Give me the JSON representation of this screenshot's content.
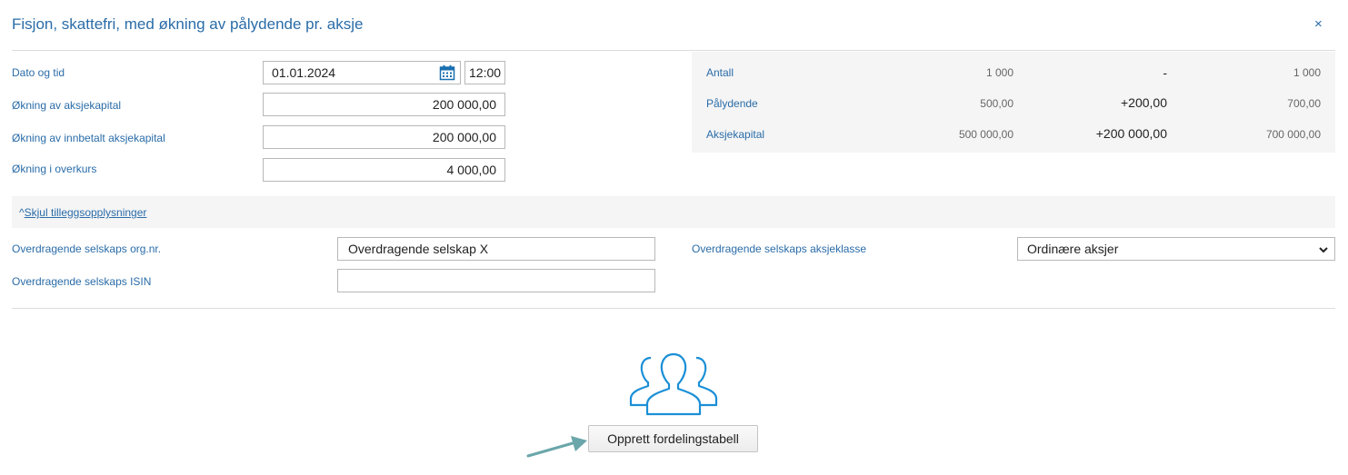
{
  "dialog": {
    "title": "Fisjon, skattefri, med økning av pålydende pr. aksje",
    "close_label": "×"
  },
  "form": {
    "date_label": "Dato og tid",
    "date_value": "01.01.2024",
    "time_value": "12:00",
    "share_capital_increase_label": "Økning av aksjekapital",
    "share_capital_increase_value": "200 000,00",
    "paid_in_capital_increase_label": "Økning av innbetalt aksjekapital",
    "paid_in_capital_increase_value": "200 000,00",
    "premium_increase_label": "Økning i overkurs",
    "premium_increase_value": "4 000,00"
  },
  "summary": {
    "rows": [
      {
        "label": "Antall",
        "before": "1 000",
        "change": "-",
        "after": "1 000"
      },
      {
        "label": "Pålydende",
        "before": "500,00",
        "change": "+200,00",
        "after": "700,00"
      },
      {
        "label": "Aksjekapital",
        "before": "500 000,00",
        "change": "+200 000,00",
        "after": "700 000,00"
      }
    ]
  },
  "additional": {
    "toggle_caret": "^",
    "toggle_label": "Skjul tilleggsopplysninger",
    "transferring_org_label": "Overdragende selskaps org.nr.",
    "transferring_org_value": "Overdragende selskap X",
    "transferring_isin_label": "Overdragende selskaps ISIN",
    "transferring_isin_value": "",
    "transferring_class_label": "Overdragende selskaps aksjeklasse",
    "transferring_class_value": "Ordinære aksjer"
  },
  "distribution": {
    "button_label": "Opprett fordelingstabell"
  },
  "icons": {
    "calendar": "calendar-icon",
    "people": "people-group-icon",
    "select_arrow": "chevron-down-icon",
    "pointer_arrow": "arrow-right-icon"
  },
  "colors": {
    "accent": "#2a6ca8",
    "icon_blue": "#1a8fd6",
    "arrow_teal": "#6aa6aa"
  }
}
